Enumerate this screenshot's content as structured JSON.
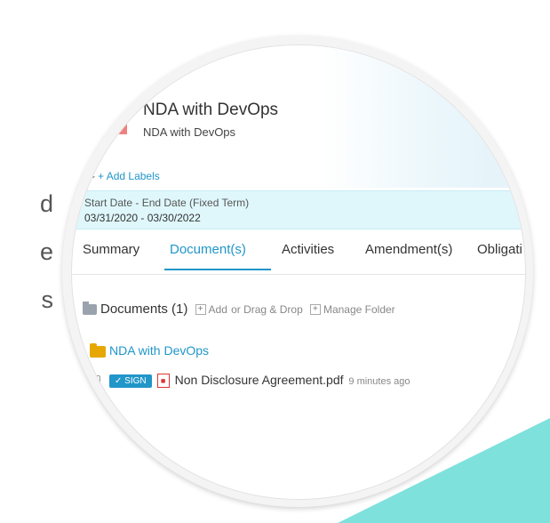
{
  "colors": {
    "accent": "#2196c9",
    "doc_icon": "#f08080",
    "band": "#dff7fb",
    "triangle": "#7fe1dc"
  },
  "side_text": [
    "d",
    "e",
    "s"
  ],
  "header": {
    "title": "NDA with DevOps",
    "subtitle": "NDA with DevOps",
    "add_labels": "+ Add Labels",
    "tag_icon": "tag-icon"
  },
  "dates": {
    "label": "Start Date - End Date (Fixed Term)",
    "value": "03/31/2020 - 03/30/2022"
  },
  "tabs": [
    {
      "label": "Summary",
      "active": false
    },
    {
      "label": "Document(s)",
      "active": true
    },
    {
      "label": "Activities",
      "active": false
    },
    {
      "label": "Amendment(s)",
      "active": false
    },
    {
      "label": "Obligati",
      "active": false
    }
  ],
  "documents": {
    "heading": "Documents (1)",
    "add": "Add",
    "drag_drop": "or Drag & Drop",
    "manage_folder": "Manage Folder"
  },
  "folder": {
    "name": "NDA with DevOps"
  },
  "file": {
    "sign_label": "SIGN",
    "name": "Non Disclosure Agreement.pdf",
    "time": "9 minutes ago"
  }
}
